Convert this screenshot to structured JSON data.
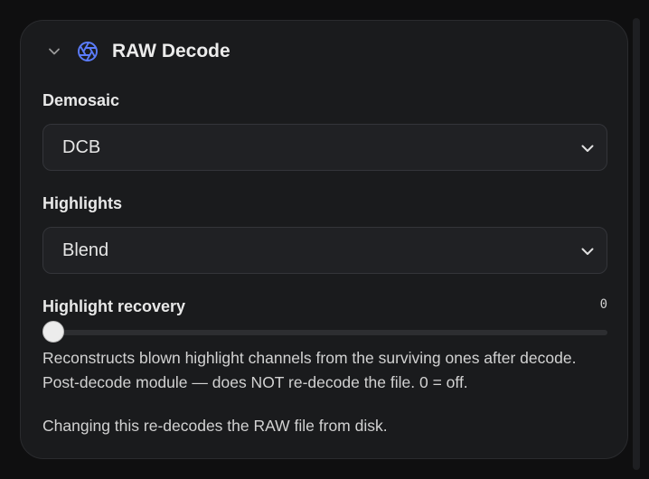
{
  "panel": {
    "title": "RAW Decode",
    "icon": "aperture-icon",
    "accent_color": "#5b7cfa"
  },
  "demosaic": {
    "label": "Demosaic",
    "value": "DCB"
  },
  "highlights": {
    "label": "Highlights",
    "value": "Blend"
  },
  "highlight_recovery": {
    "label": "Highlight recovery",
    "value": "0",
    "slider_fraction": 0
  },
  "help": {
    "line1": "Reconstructs blown highlight channels from the surviving ones after decode.",
    "line2": "Post-decode module — does NOT re-decode the file. 0 = off.",
    "note": "Changing this re-decodes the RAW file from disk."
  }
}
